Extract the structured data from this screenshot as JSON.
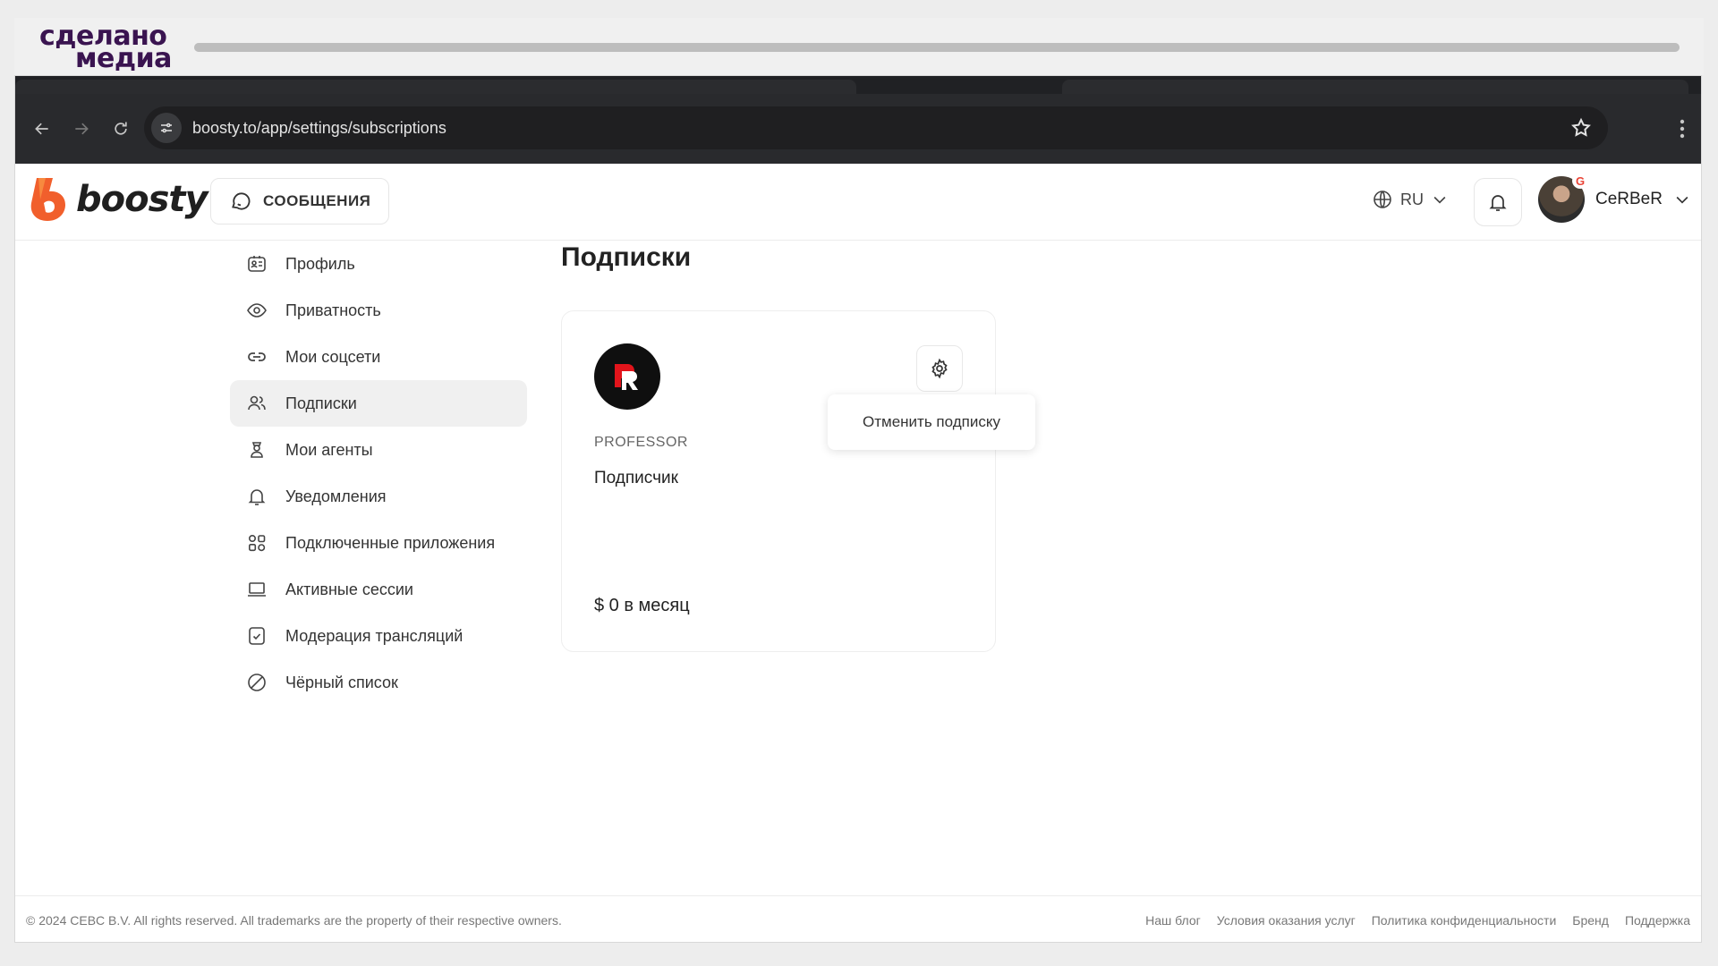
{
  "watermark": {
    "line1": "сделано",
    "line2": "медиа"
  },
  "browser": {
    "url": "boosty.to/app/settings/subscriptions"
  },
  "header": {
    "logo_text": "boosty",
    "messages_label": "СООБЩЕНИЯ",
    "language": "RU",
    "username": "CeRBeR"
  },
  "sidebar": {
    "items": [
      {
        "label": "Профиль",
        "icon": "profile-card-icon"
      },
      {
        "label": "Приватность",
        "icon": "eye-icon"
      },
      {
        "label": "Мои соцсети",
        "icon": "link-icon"
      },
      {
        "label": "Подписки",
        "icon": "users-icon",
        "active": true
      },
      {
        "label": "Мои агенты",
        "icon": "agent-icon"
      },
      {
        "label": "Уведомления",
        "icon": "bell-icon"
      },
      {
        "label": "Подключенные приложения",
        "icon": "apps-icon"
      },
      {
        "label": "Активные сессии",
        "icon": "laptop-icon"
      },
      {
        "label": "Модерация трансляций",
        "icon": "shield-check-icon"
      },
      {
        "label": "Чёрный список",
        "icon": "block-icon"
      }
    ]
  },
  "main": {
    "title": "Подписки",
    "subscription": {
      "creator": "PROFESSOR",
      "tier": "Подписчик",
      "price": "$ 0 в месяц",
      "menu_option": "Отменить подписку"
    }
  },
  "footer": {
    "copyright": "© 2024 CEBC B.V. All rights reserved. All trademarks are the property of their respective owners.",
    "links": [
      "Наш блог",
      "Условия оказания услуг",
      "Политика конфиденциальности",
      "Бренд",
      "Поддержка"
    ]
  },
  "colors": {
    "brand_orange": "#f15f2c",
    "chrome_dark": "#292a2d",
    "watermark_purple": "#3a1450"
  }
}
